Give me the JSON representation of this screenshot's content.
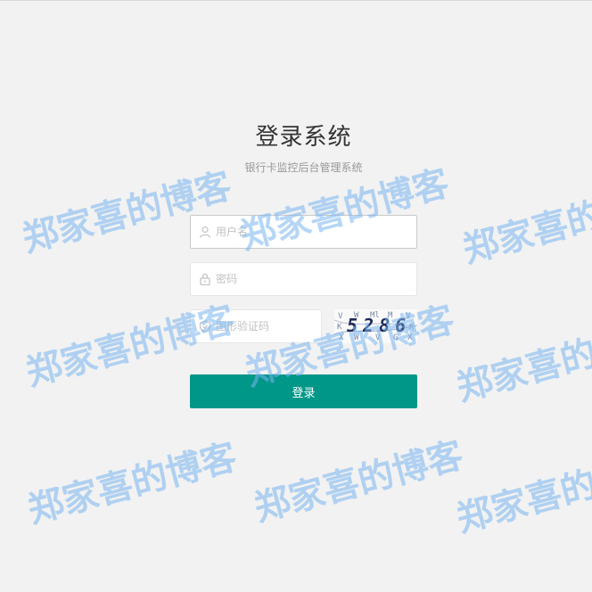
{
  "login": {
    "title": "登录系统",
    "subtitle": "银行卡监控后台管理系统",
    "username_placeholder": "用户名",
    "password_placeholder": "密码",
    "captcha_placeholder": "图形验证码",
    "captcha_text": "5286",
    "submit_label": "登录"
  },
  "watermark": {
    "text": "郑家喜的博客"
  },
  "colors": {
    "primary": "#009688",
    "background": "#f2f2f2",
    "watermark": "#78b4f0"
  },
  "icons": {
    "user": "user-icon",
    "lock": "lock-icon",
    "shield": "shield-icon"
  }
}
